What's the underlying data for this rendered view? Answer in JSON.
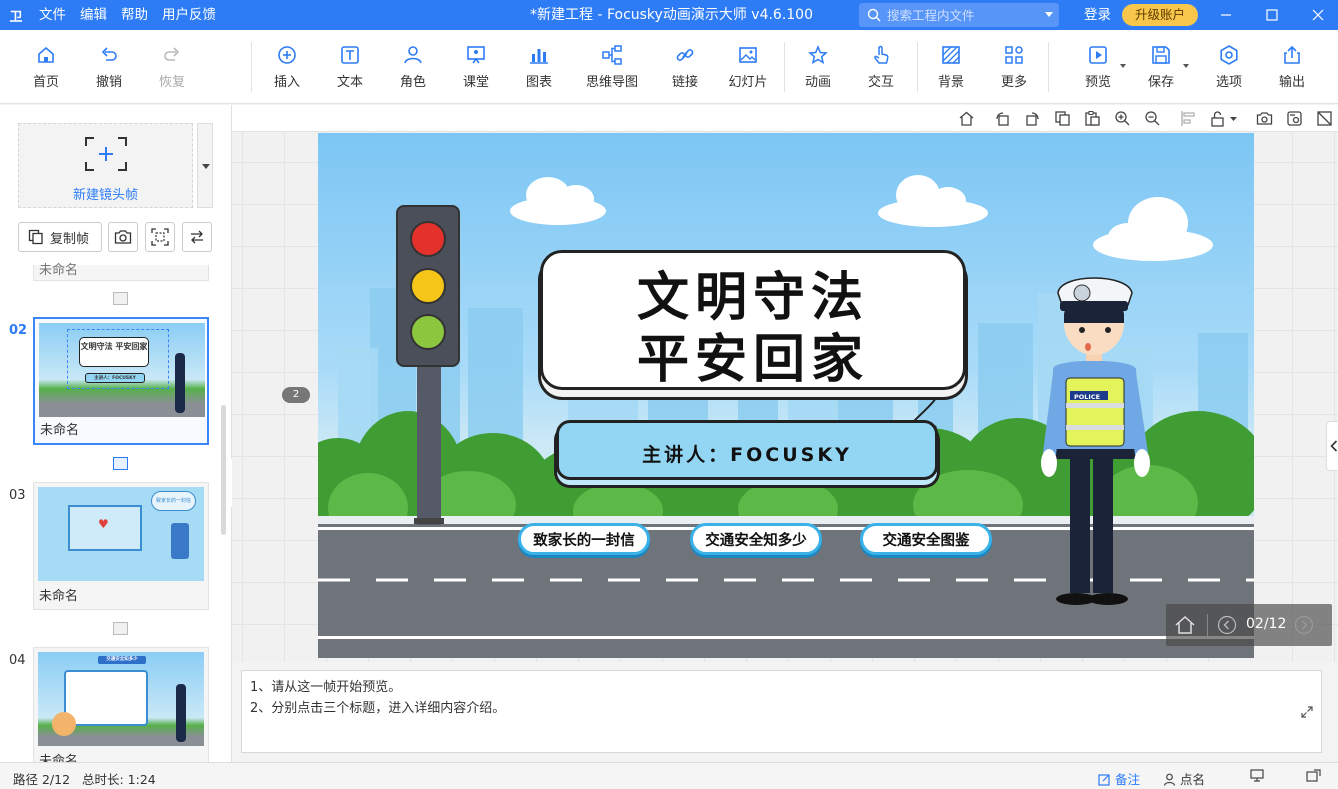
{
  "titlebar": {
    "logo": "卫",
    "menu": [
      "文件",
      "编辑",
      "帮助",
      "用户反馈"
    ],
    "title": "*新建工程 - Focusky动画演示大师  v4.6.100",
    "search_placeholder": "搜索工程内文件",
    "login": "登录",
    "upgrade": "升级账户"
  },
  "toolbar": {
    "home": "首页",
    "undo": "撤销",
    "redo": "恢复",
    "insert": "插入",
    "text": "文本",
    "character": "角色",
    "classroom": "课堂",
    "chart": "图表",
    "mindmap": "思维导图",
    "link": "链接",
    "slideshow": "幻灯片",
    "animation": "动画",
    "interaction": "交互",
    "background": "背景",
    "more": "更多",
    "preview": "预览",
    "save": "保存",
    "options": "选项",
    "export": "输出"
  },
  "leftpanel": {
    "new_frame": "新建镜头帧",
    "copy_frame": "复制帧",
    "partial_prev_name": "未命名",
    "slides": [
      {
        "num": "02",
        "name": "未命名",
        "thumb_title": "文明守法 平安回家",
        "thumb_sub": "主讲人：FOCUSKY"
      },
      {
        "num": "03",
        "name": "未命名",
        "thumb_title": "致家长的一封信"
      },
      {
        "num": "04",
        "name": "未命名",
        "thumb_title": "交通安全知多少"
      }
    ]
  },
  "canvas": {
    "frame_badge": "2",
    "slide": {
      "title_line1": "文明守法",
      "title_line2": "平安回家",
      "presenter": "主讲人：FOCUSKY",
      "buttons": [
        "致家长的一封信",
        "交通安全知多少",
        "交通安全图鉴"
      ],
      "police_badge": "POLICE"
    },
    "nav_counter": "02/12"
  },
  "notes": {
    "line1": "1、请从这一帧开始预览。",
    "line2": "2、分别点击三个标题，进入详细内容介绍。"
  },
  "statusbar": {
    "path": "路径 2/12",
    "duration": "总时长: 1:24",
    "notes": "备注",
    "rollcall": "点名"
  },
  "colors": {
    "brand_blue": "#2d7cf6",
    "upgrade_gold": "#f7c64a",
    "sky": "#7cc6f4",
    "grass": "#4caa3a",
    "road": "#6f747a"
  }
}
